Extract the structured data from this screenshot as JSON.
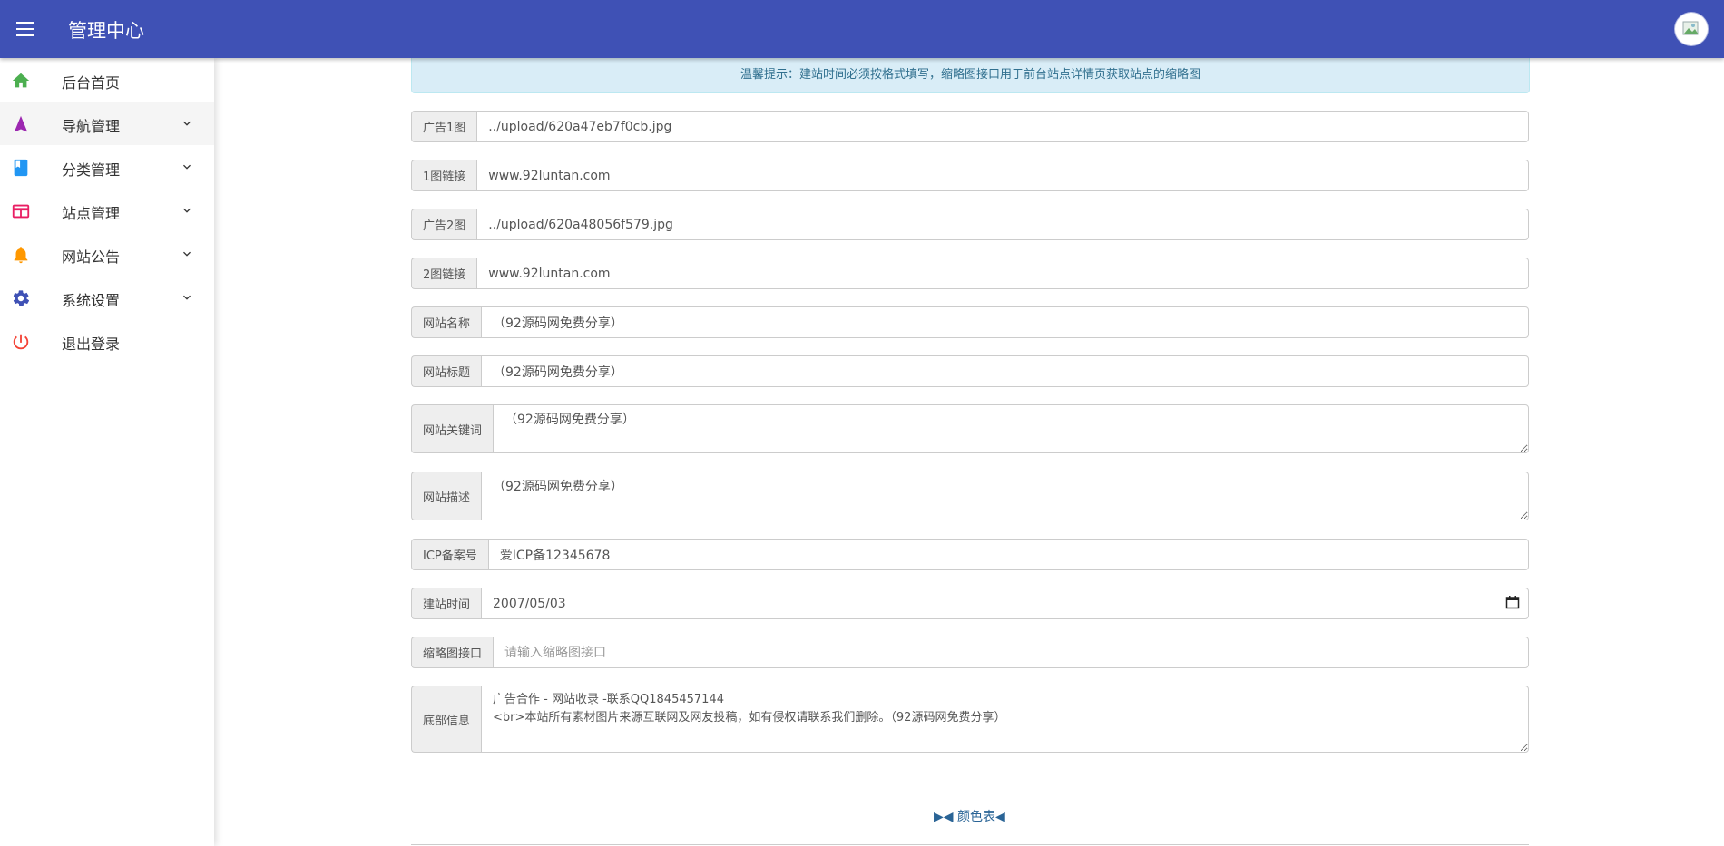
{
  "header": {
    "title": "管理中心"
  },
  "sidebar": {
    "items": [
      {
        "label": "后台首页",
        "icon": "home-icon",
        "color": "#4caf50",
        "expandable": false
      },
      {
        "label": "导航管理",
        "icon": "navigation-icon",
        "color": "#9c27b0",
        "expandable": true
      },
      {
        "label": "分类管理",
        "icon": "book-icon",
        "color": "#2196f3",
        "expandable": true
      },
      {
        "label": "站点管理",
        "icon": "web-icon",
        "color": "#e91e63",
        "expandable": true
      },
      {
        "label": "网站公告",
        "icon": "bell-icon",
        "color": "#ff9800",
        "expandable": true
      },
      {
        "label": "系统设置",
        "icon": "gear-icon",
        "color": "#3f51b5",
        "expandable": true
      },
      {
        "label": "退出登录",
        "icon": "power-icon",
        "color": "#f44336",
        "expandable": false
      }
    ]
  },
  "alert": {
    "text": "温馨提示：建站时间必须按格式填写，缩略图接口用于前台站点详情页获取站点的缩略图"
  },
  "form": {
    "ad1_image": {
      "label": "广告1图",
      "value": "../upload/620a47eb7f0cb.jpg"
    },
    "ad1_link": {
      "label": "1图链接",
      "value": "www.92luntan.com"
    },
    "ad2_image": {
      "label": "广告2图",
      "value": "../upload/620a48056f579.jpg"
    },
    "ad2_link": {
      "label": "2图链接",
      "value": "www.92luntan.com"
    },
    "site_name": {
      "label": "网站名称",
      "value": "（92源码网免费分享）"
    },
    "site_title": {
      "label": "网站标题",
      "value": "（92源码网免费分享）"
    },
    "site_keywords": {
      "label": "网站关键词",
      "value": "（92源码网免费分享）"
    },
    "site_description": {
      "label": "网站描述",
      "value": "（92源码网免费分享）"
    },
    "icp": {
      "label": "ICP备案号",
      "value": "爱ICP备12345678"
    },
    "build_date": {
      "label": "建站时间",
      "value": "2007/05/03"
    },
    "thumb_api": {
      "label": "缩略图接口",
      "value": "",
      "placeholder": "请输入缩略图接口"
    },
    "footer_info": {
      "label": "底部信息",
      "value": "广告合作 - 网站收录 -联系QQ1845457144\n<br>本站所有素材图片来源互联网及网友投稿，如有侵权请联系我们删除。（92源码网免费分享）"
    }
  },
  "color_table": {
    "label": "▶◀ 颜色表◀"
  },
  "colors": {
    "header_bg": "#3f51b5",
    "alert_bg": "#d9edf7",
    "alert_text": "#31708f"
  }
}
